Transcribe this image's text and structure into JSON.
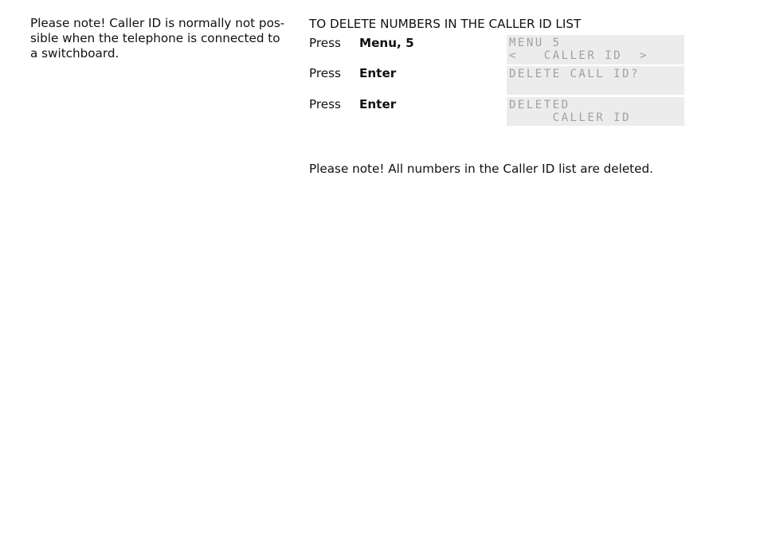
{
  "left_note": "Please note! Caller ID is normally not pos-\nsible when the telephone is connected to\na switchboard.",
  "left_note_lines": [
    "Please note! Caller ID is normally not pos-",
    "sible when the telephone is connected to",
    "a switchboard."
  ],
  "section_title": "TO DELETE NUMBERS IN THE CALLER ID LIST",
  "steps": [
    {
      "action": "Press",
      "key": "Menu, 5",
      "display": [
        "MENU 5",
        "<   CALLER ID  >"
      ]
    },
    {
      "action": "Press",
      "key": "Enter",
      "display": [
        "DELETE CALL ID?",
        ""
      ]
    },
    {
      "action": "Press",
      "key": "Enter",
      "display": [
        "DELETED",
        "     CALLER ID"
      ]
    }
  ],
  "bottom_note": "Please note! All numbers in the Caller ID list are deleted."
}
